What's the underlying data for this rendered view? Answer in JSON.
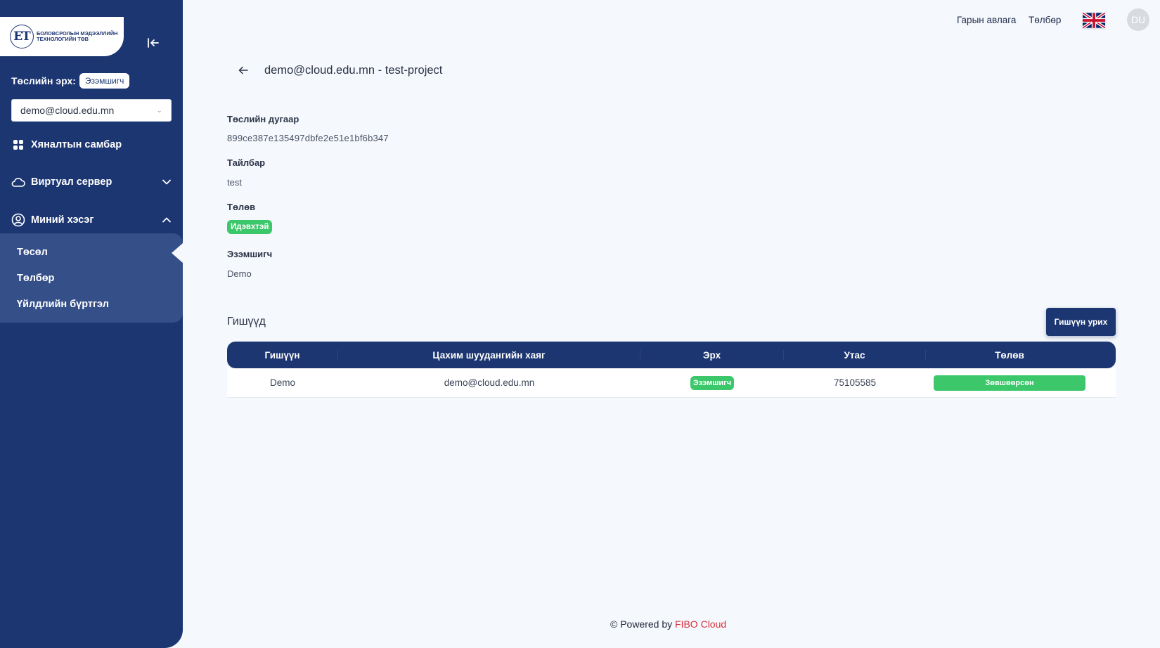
{
  "sidebar": {
    "logo_mark": "ЕТ",
    "logo_text": "Боловсролын мэдээллийн технологийн төв",
    "role_label": "Төслийн эрх:",
    "role_value": "Эзэмшигч",
    "project_selected": "demo@cloud.edu.mn",
    "nav": {
      "dashboard": "Хяналтын самбар",
      "virtual_server": "Виртуал сервер",
      "my_account": "Миний хэсэг"
    },
    "submenu": {
      "project": "Төсөл",
      "payment": "Төлбөр",
      "activity_log": "Үйлдлийн бүртгэл"
    },
    "icons": {
      "collapse": "collapse-left-icon",
      "dashboard": "grid-icon",
      "virtual_server": "cloud-icon",
      "my_account": "user-circle-icon"
    }
  },
  "topbar": {
    "guide": "Гарын авлага",
    "payment": "Төлбөр",
    "avatar": "DU"
  },
  "main": {
    "title": "demo@cloud.edu.mn - test-project",
    "fields": {
      "project_id_label": "Төслийн дугаар",
      "project_id": "899ce387e135497dbfe2e51e1bf6b347",
      "description_label": "Тайлбар",
      "description": "test",
      "status_label": "Төлөв",
      "status": "Идэвхтэй",
      "owner_label": "Эзэмшигч",
      "owner": "Demo"
    },
    "members": {
      "title": "Гишүүд",
      "invite_button": "Гишүүн урих",
      "columns": [
        "Гишүүн",
        "Цахим шуудангийн хаяг",
        "Эрх",
        "Утас",
        "Төлөв"
      ],
      "rows": [
        {
          "member": "Demo",
          "email": "demo@cloud.edu.mn",
          "role": "Эзэмшигч",
          "phone": "75105585",
          "status": "Зөвшөөрсөн"
        }
      ]
    }
  },
  "footer": {
    "prefix": "© Powered by",
    "brand": "FIBO Cloud"
  },
  "colors": {
    "primary": "#1c3672",
    "success": "#3cc76a",
    "brand_red": "#d9303a",
    "background": "#f5f8fc"
  }
}
